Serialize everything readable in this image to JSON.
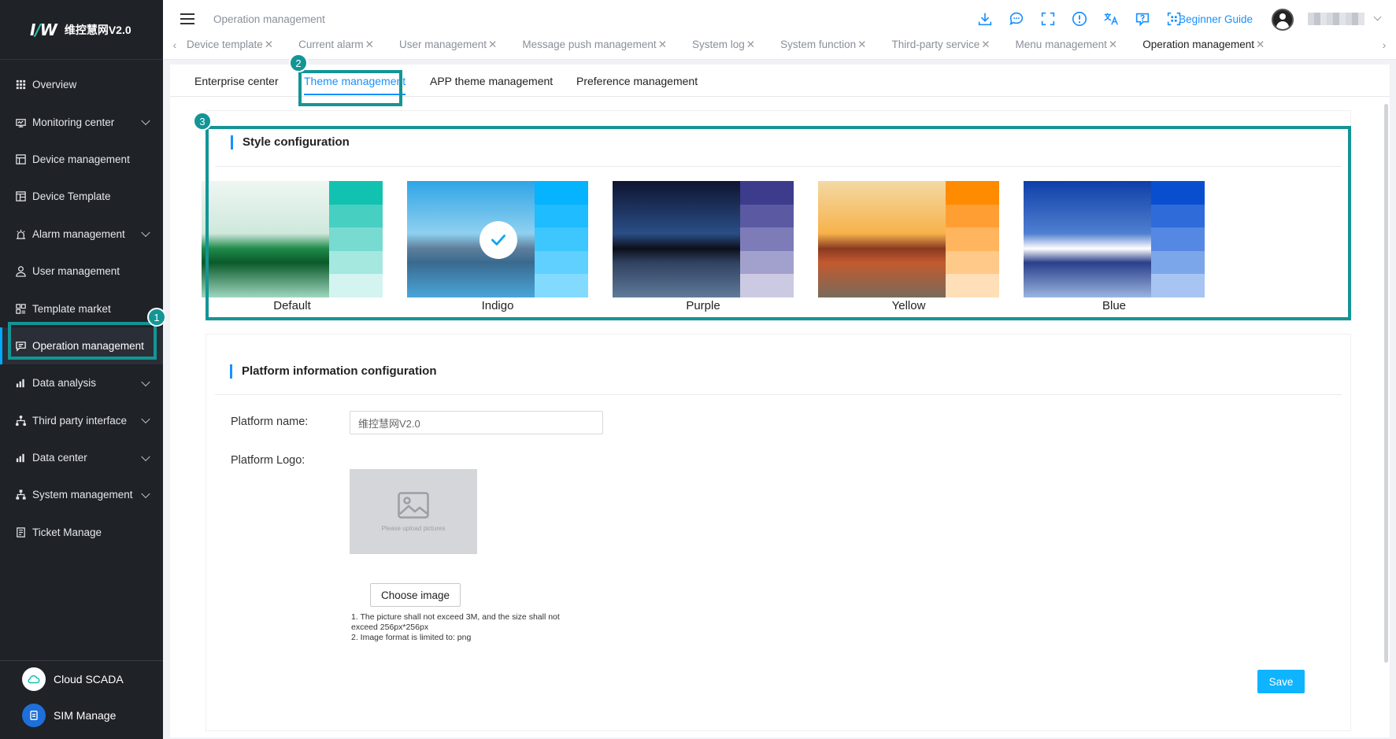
{
  "app": {
    "logo_mark": "W",
    "logo_name": "维控慧网V2.0"
  },
  "sidebar": {
    "items": [
      {
        "label": "Overview",
        "icon": "grid-icon",
        "has_children": false
      },
      {
        "label": "Monitoring center",
        "icon": "monitor-icon",
        "has_children": true
      },
      {
        "label": "Device management",
        "icon": "device-icon",
        "has_children": false
      },
      {
        "label": "Device Template",
        "icon": "template-icon",
        "has_children": false
      },
      {
        "label": "Alarm management",
        "icon": "alarm-icon",
        "has_children": true
      },
      {
        "label": "User management",
        "icon": "user-icon",
        "has_children": false
      },
      {
        "label": "Template market",
        "icon": "market-icon",
        "has_children": false
      },
      {
        "label": "Operation management",
        "icon": "operation-icon",
        "has_children": false,
        "active": true
      },
      {
        "label": "Data analysis",
        "icon": "bar-chart-icon",
        "has_children": true
      },
      {
        "label": "Third party interface",
        "icon": "network-icon",
        "has_children": true
      },
      {
        "label": "Data center",
        "icon": "bar-chart-icon",
        "has_children": true
      },
      {
        "label": "System management",
        "icon": "hierarchy-icon",
        "has_children": true
      },
      {
        "label": "Ticket Manage",
        "icon": "ticket-icon",
        "has_children": false
      }
    ],
    "bottom": [
      {
        "label": "Cloud SCADA",
        "icon": "cloud-icon"
      },
      {
        "label": "SIM Manage",
        "icon": "sim-icon"
      }
    ]
  },
  "header": {
    "breadcrumb": "Operation management",
    "guide_label": "Beginner Guide",
    "icons": [
      "download-icon",
      "message-icon",
      "fullscreen-icon",
      "alert-icon",
      "translate-icon",
      "help-icon",
      "scan-icon"
    ],
    "tabs": [
      {
        "label": "Device template",
        "active": false
      },
      {
        "label": "Current alarm",
        "active": false
      },
      {
        "label": "User management",
        "active": false
      },
      {
        "label": "Message push management",
        "active": false
      },
      {
        "label": "System log",
        "active": false
      },
      {
        "label": "System function",
        "active": false
      },
      {
        "label": "Third-party service",
        "active": false
      },
      {
        "label": "Menu management",
        "active": false
      },
      {
        "label": "Operation management",
        "active": true
      }
    ],
    "close_glyph": "✕"
  },
  "subtabs": [
    {
      "label": "Enterprise center",
      "active": false
    },
    {
      "label": "Theme management",
      "active": true
    },
    {
      "label": "APP theme management",
      "active": false
    },
    {
      "label": "Preference management",
      "active": false
    }
  ],
  "style_config": {
    "title": "Style configuration",
    "themes": [
      {
        "name": "Default",
        "selected": false,
        "swatches": [
          "#12c2b0",
          "#47cfc1",
          "#77dbd1",
          "#a4e8e0",
          "#d3f4f0"
        ],
        "scene": [
          "#eef6f2",
          "#cfe8dc",
          "#1f8a4a",
          "#0b5a2a",
          "#9fd7bf"
        ]
      },
      {
        "name": "Indigo",
        "selected": true,
        "swatches": [
          "#05b3ff",
          "#1fbcff",
          "#3ec6ff",
          "#5fd0ff",
          "#82dbff"
        ],
        "scene": [
          "#2fa5e6",
          "#8fd0f0",
          "#5d7f9c",
          "#3a6a8f",
          "#49a6d9"
        ]
      },
      {
        "name": "Purple",
        "selected": false,
        "swatches": [
          "#3c3b8c",
          "#5a59a2",
          "#7d7cb8",
          "#a2a1cd",
          "#cbcae2"
        ],
        "scene": [
          "#0e1430",
          "#2a4e86",
          "#0c0f1a",
          "#304260",
          "#607a9a"
        ]
      },
      {
        "name": "Yellow",
        "selected": false,
        "swatches": [
          "#ff8b00",
          "#ff9f33",
          "#ffb45e",
          "#ffc98a",
          "#ffdfb8"
        ],
        "scene": [
          "#f3d9a4",
          "#f7b24a",
          "#8a3a22",
          "#c25a2e",
          "#7a6a5a"
        ]
      },
      {
        "name": "Blue",
        "selected": false,
        "swatches": [
          "#0a4ed0",
          "#2f6bd9",
          "#5588e2",
          "#7ca6ea",
          "#a8c4f2"
        ],
        "scene": [
          "#0e3fa8",
          "#4f7fd0",
          "#ffffff",
          "#2a3f8a",
          "#9ab5e0"
        ]
      }
    ]
  },
  "platform_config": {
    "title": "Platform information configuration",
    "name_label": "Platform name:",
    "name_value": "维控慧网V2.0",
    "logo_label": "Platform Logo:",
    "upload_placeholder": "Please upload pictures",
    "choose_label": "Choose image",
    "hint_line1": "1. The picture shall not exceed 3M, and the size shall not",
    "hint_line2": "exceed 256px*256px",
    "hint_line3": "2. Image format is limited to: png",
    "save_label": "Save"
  },
  "annotations": [
    "1",
    "2",
    "3"
  ],
  "colors": {
    "accent": "#1890ff",
    "highlight": "#139596",
    "sidebar_bg": "#1f2227",
    "save": "#0fb4ff"
  }
}
